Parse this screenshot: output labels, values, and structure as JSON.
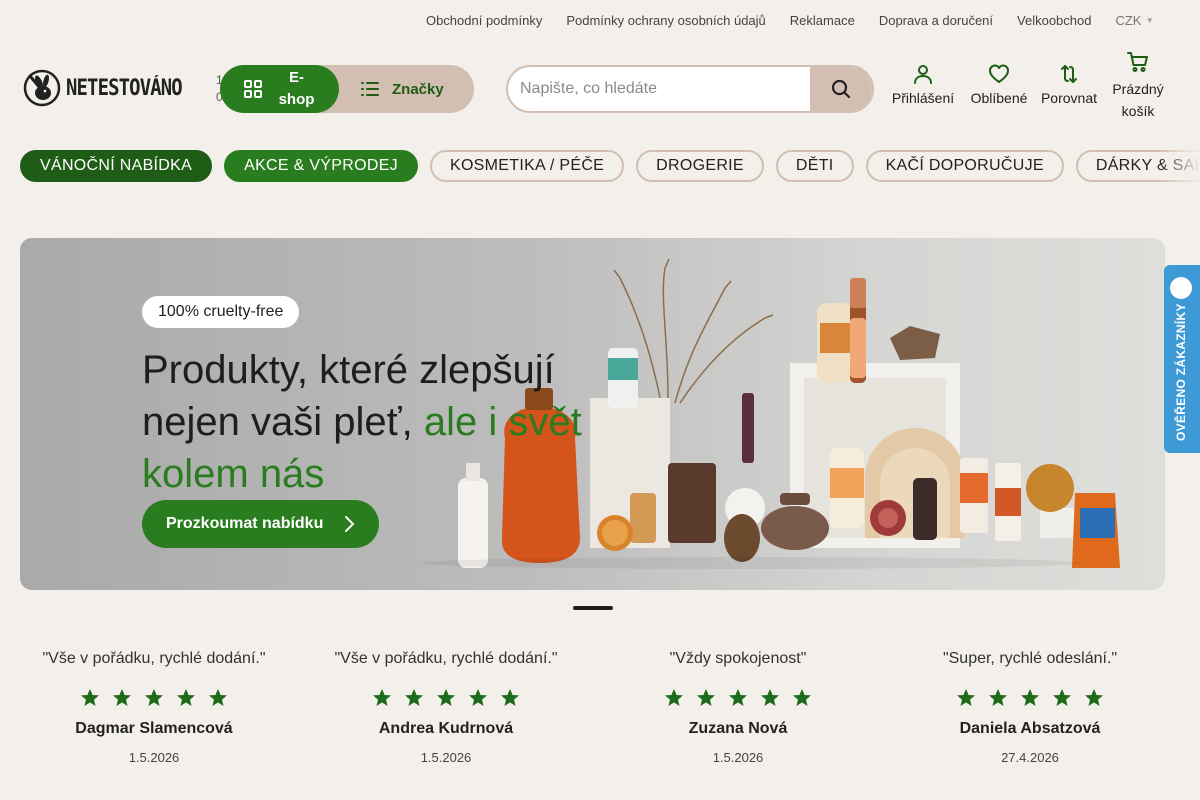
{
  "top_links": [
    "Obchodní podmínky",
    "Podmínky ochrany osobních údajů",
    "Reklamace",
    "Doprava a doručení",
    "Velkoobchod"
  ],
  "currency": {
    "label": "CZK",
    "icon": "chevron-down-icon"
  },
  "header": {
    "logo_text": "NETESTOVÁNO",
    "mini_nums": [
      "1",
      "0"
    ],
    "eshop_label": "E-shop",
    "brands_label": "Značky",
    "search_placeholder": "Napište, co hledáte",
    "actions": {
      "login": "Přihlášení",
      "favorites": "Oblíbené",
      "compare": "Porovnat",
      "cart": "Prázdný košík"
    }
  },
  "categories": [
    "VÁNOČNÍ NABÍDKA",
    "AKCE & VÝPRODEJ",
    "KOSMETIKA / PÉČE",
    "DROGERIE",
    "DĚTI",
    "KAČÍ DOPORUČUJE",
    "DÁRKY & SADY"
  ],
  "hero": {
    "badge": "100% cruelty-free",
    "headline_part1": "Produkty, které zlepšují nejen vaši pleť,",
    "headline_accent": "ale i svět kolem nás",
    "cta_label": "Prozkoumat nabídku"
  },
  "side_tab": {
    "label": "OVĚŘENO ZÁKAZNÍKY"
  },
  "reviews": [
    {
      "quote": "\"Vše v pořádku, rychlé dodání.\"",
      "name": "Dagmar Slamencová",
      "date": "1.5.2026",
      "rating": 5
    },
    {
      "quote": "\"Vše v pořádku, rychlé dodání.\"",
      "name": "Andrea Kudrnová",
      "date": "1.5.2026",
      "rating": 5
    },
    {
      "quote": "\"Vždy spokojenost\"",
      "name": "Zuzana Nová",
      "date": "1.5.2026",
      "rating": 5
    },
    {
      "quote": "\"Super, rychlé odeslání.\"",
      "name": "Daniela Absatzová",
      "date": "27.4.2026",
      "rating": 5
    }
  ],
  "colors": {
    "brand_green": "#2a7d1e",
    "dark_green": "#1f5c16",
    "beige": "#d2bfb1",
    "background": "#f3efea",
    "star_green": "#1f6b1a"
  }
}
